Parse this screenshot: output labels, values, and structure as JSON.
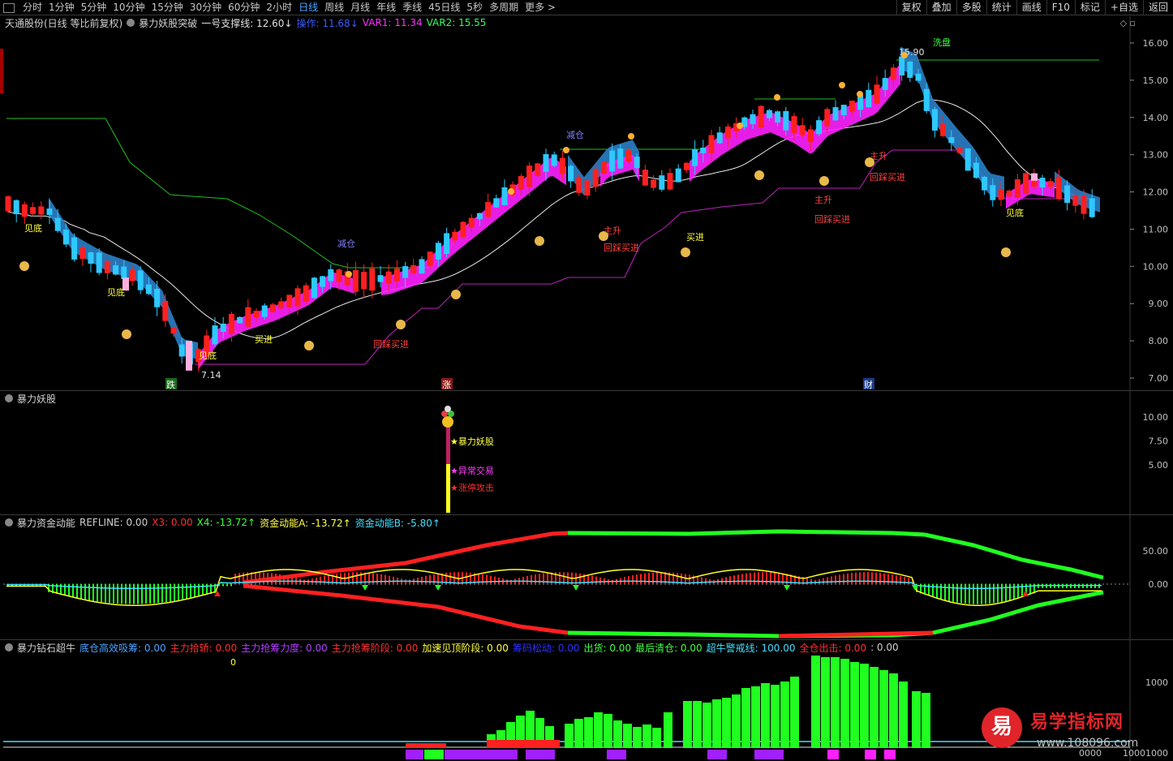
{
  "toolbar": {
    "periods": [
      "分时",
      "1分钟",
      "5分钟",
      "10分钟",
      "15分钟",
      "30分钟",
      "60分钟",
      "2小时",
      "日线",
      "周线",
      "月线",
      "年线",
      "季线",
      "45日线",
      "5秒",
      "多周期",
      "更多 >"
    ],
    "active_period": "日线",
    "right_buttons": [
      "复权",
      "叠加",
      "多股",
      "统计",
      "画线",
      "F10",
      "标记",
      "+自选",
      "返回"
    ]
  },
  "main_panel": {
    "title": "天通股份(日线 等比前复权)",
    "indicator": "暴力妖股突破",
    "line1": "一号支撑线: 12.60↓",
    "line2": "操作: 11.68↓",
    "var1": "VAR1: 11.34",
    "var2": "VAR2: 15.55",
    "y_labels": [
      "16.00",
      "15.00",
      "14.00",
      "13.00",
      "12.00",
      "11.00",
      "10.00",
      "9.00",
      "8.00",
      "7.00"
    ],
    "high_label": "15.90",
    "low_label": "7.14",
    "annotations": {
      "wash": "洗盘",
      "bottom1": "见底",
      "bottom2": "见底",
      "bottom3": "见底",
      "bottom4": "见底",
      "reduce1": "减仓",
      "reduce2": "减仓",
      "buy1": "买进",
      "buy2": "买进",
      "pullback1": "回踩买进",
      "pullback2": "回踩买进",
      "pullback3": "回踩买进",
      "pullback4": "回踩买进",
      "rise1": "主升",
      "rise2": "主升",
      "rise3": "主升",
      "tag_fall": "跌",
      "tag_rise": "涨",
      "tag_money": "财"
    }
  },
  "panel2": {
    "title": "暴力妖股",
    "y_labels": [
      "10.00",
      "7.50",
      "5.00"
    ],
    "labels": [
      "暴力妖股",
      "异常交易",
      "涨停攻击"
    ]
  },
  "panel3": {
    "title": "暴力资金动能",
    "refline": "REFLINE: 0.00",
    "x3": "X3: 0.00",
    "x4": "X4: -13.72↑",
    "a": "资金动能A: -13.72↑",
    "b": "资金动能B: -5.80↑",
    "y_labels": [
      "50.00",
      "0.00"
    ]
  },
  "panel4": {
    "title": "暴力钻石超牛",
    "items": [
      {
        "text": "底仓高效吸筹: 0.00",
        "color": "#4aa3ff"
      },
      {
        "text": "主力拾轿: 0.00",
        "color": "#ff3030"
      },
      {
        "text": "主力抢筹力度: 0.00",
        "color": "#b040ff"
      },
      {
        "text": "主力抢筹阶段: 0.00",
        "color": "#ff3030"
      },
      {
        "text": "加速见顶阶段: 0.00",
        "color": "#ffff40"
      },
      {
        "text": "筹码松动: 0.00",
        "color": "#3030ff"
      },
      {
        "text": "出货: 0.00",
        "color": "#40ff40"
      },
      {
        "text": "最后清仓: 0.00",
        "color": "#40ff40"
      },
      {
        "text": "超牛警戒线: 100.00",
        "color": "#40e0ff"
      },
      {
        "text": "全仓出击: 0.00",
        "color": "#ff3030"
      },
      {
        "text": ": 0.00",
        "color": "#d0d0d0"
      }
    ],
    "zero_label": "0",
    "y_labels": [
      "1000",
      "0000",
      "10001000"
    ]
  },
  "watermark": {
    "logo": "易",
    "title": "易学指标网",
    "url": "www.108096.com"
  },
  "colors": {
    "up": "#ff2020",
    "down": "#2ec8ff",
    "magenta": "#ff20ff",
    "blue_band": "#2a7fc8",
    "green": "#20ff20",
    "yellow": "#ffff20"
  }
}
